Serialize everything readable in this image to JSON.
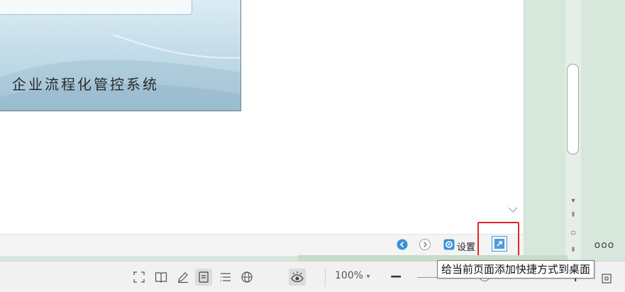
{
  "document": {
    "slide_title": "企业流程化管控系统"
  },
  "page_footer": {
    "settings_label": "设置",
    "icons": [
      "back-circle-icon",
      "forward-circle-icon",
      "settings-gear-icon",
      "desktop-shortcut-icon"
    ]
  },
  "status_bar": {
    "zoom_value": "100%",
    "zoom_dropdown": "▾",
    "zoom_minus": "−",
    "zoom_plus": "+",
    "view_icons": [
      "fullscreen-icon",
      "reading-mode-icon",
      "annotate-pen-icon",
      "page-view-icon",
      "outline-view-icon",
      "web-view-icon",
      "eye-protection-icon"
    ]
  },
  "side_panel": {
    "more_label": "ooo"
  },
  "tooltip": {
    "text": "给当前页面添加快捷方式到桌面"
  },
  "colors": {
    "highlight": "#e3242b",
    "accent_blue": "#4f9ad6",
    "window_green": "#d7e7dc"
  }
}
